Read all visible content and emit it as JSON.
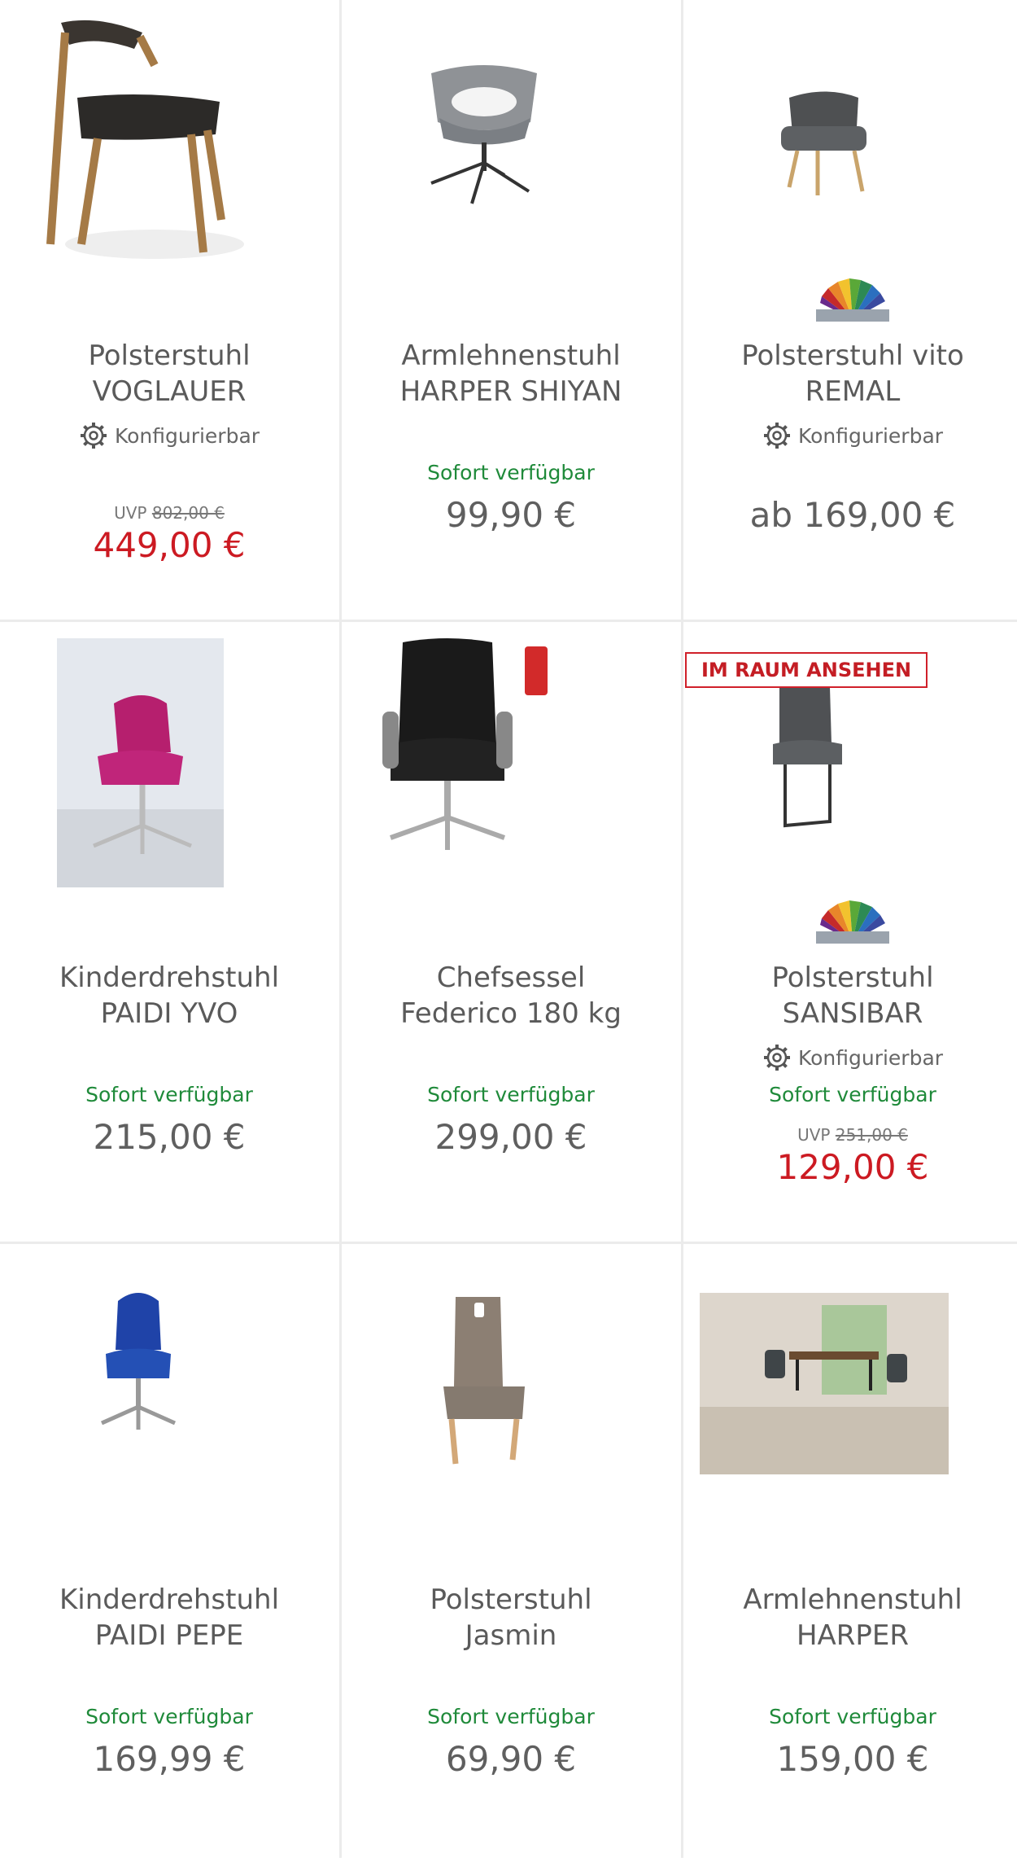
{
  "products": [
    {
      "name_line1": "Polsterstuhl",
      "name_line2": "VOGLAUER",
      "configurable_label": "Konfigurierbar",
      "uvp_label": "UVP",
      "uvp_old": "802,00 €",
      "price": "449,00 €"
    },
    {
      "name_line1": "Armlehnenstuhl",
      "name_line2": "HARPER SHIYAN",
      "availability": "Sofort verfügbar",
      "price": "99,90 €"
    },
    {
      "name_line1": "Polsterstuhl vito",
      "name_line2": "REMAL",
      "configurable_label": "Konfigurierbar",
      "price": "ab 169,00 €"
    },
    {
      "name_line1": "Kinderdrehstuhl",
      "name_line2": "PAIDI YVO",
      "availability": "Sofort verfügbar",
      "price": "215,00 €"
    },
    {
      "name_line1": "Chefsessel",
      "name_line2": "Federico 180 kg",
      "availability": "Sofort verfügbar",
      "price": "299,00 €"
    },
    {
      "badge": "IM RAUM ANSEHEN",
      "name_line1": "Polsterstuhl",
      "name_line2": "SANSIBAR",
      "configurable_label": "Konfigurierbar",
      "availability": "Sofort verfügbar",
      "uvp_label": "UVP",
      "uvp_old": "251,00 €",
      "price": "129,00 €"
    },
    {
      "name_line1": "Kinderdrehstuhl",
      "name_line2": "PAIDI PEPE",
      "availability": "Sofort verfügbar",
      "price": "169,99 €"
    },
    {
      "name_line1": "Polsterstuhl",
      "name_line2": "Jasmin",
      "availability": "Sofort verfügbar",
      "price": "69,90 €"
    },
    {
      "name_line1": "Armlehnenstuhl",
      "name_line2": "HARPER",
      "availability": "Sofort verfügbar",
      "price": "159,00 €"
    }
  ],
  "colors": {
    "available": "#1f8a3a",
    "sale_price": "#cc1a22",
    "regular_price": "#5f5f5f",
    "badge": "#c41d24"
  },
  "icons": [
    "gear-icon",
    "color-fan-icon"
  ]
}
